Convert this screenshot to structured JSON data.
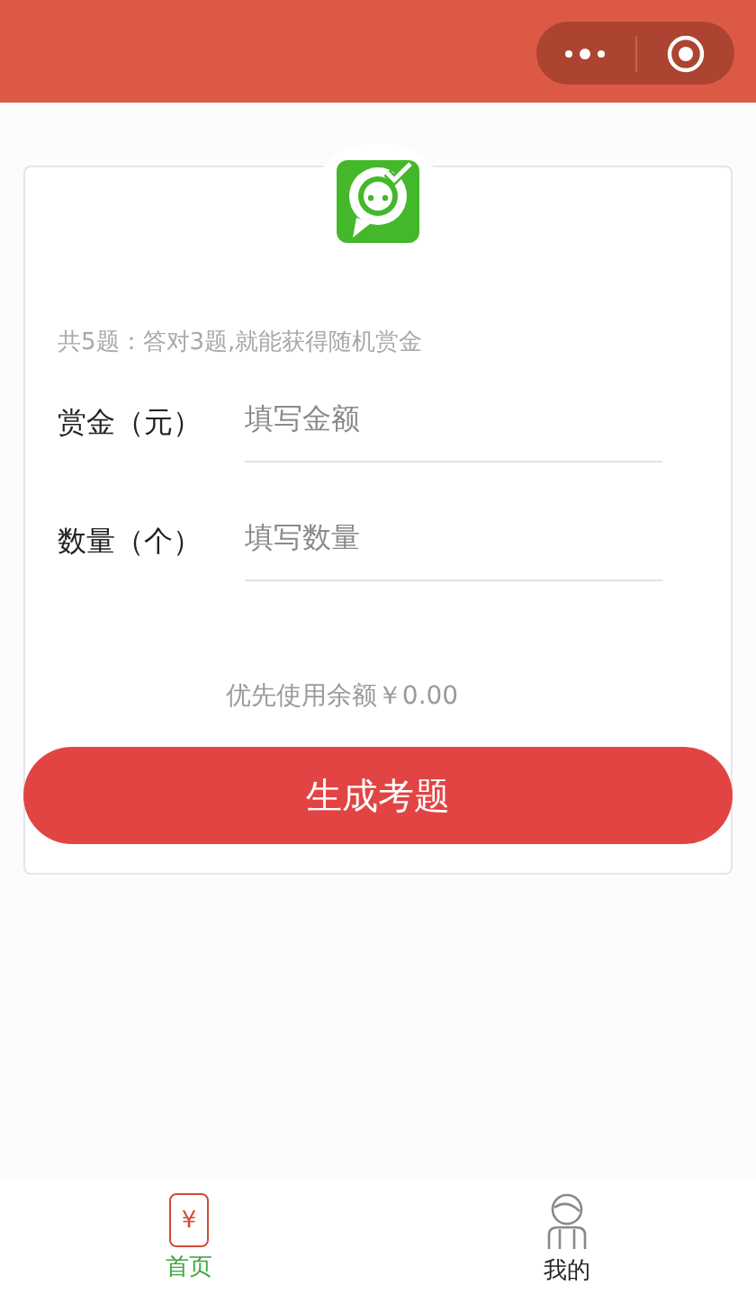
{
  "hint": "共5题：答对3题,就能获得随机赏金",
  "fields": [
    {
      "label": "赏金（元）",
      "placeholder": "填写金额"
    },
    {
      "label": "数量（个）",
      "placeholder": "填写数量"
    }
  ],
  "balance": "优先使用余额￥0.00",
  "submit": "生成考题",
  "tabs": [
    {
      "label": "首页",
      "kind": "wallet",
      "glyph": "¥",
      "selected": true
    },
    {
      "label": "我的",
      "kind": "person",
      "selected": false
    }
  ]
}
